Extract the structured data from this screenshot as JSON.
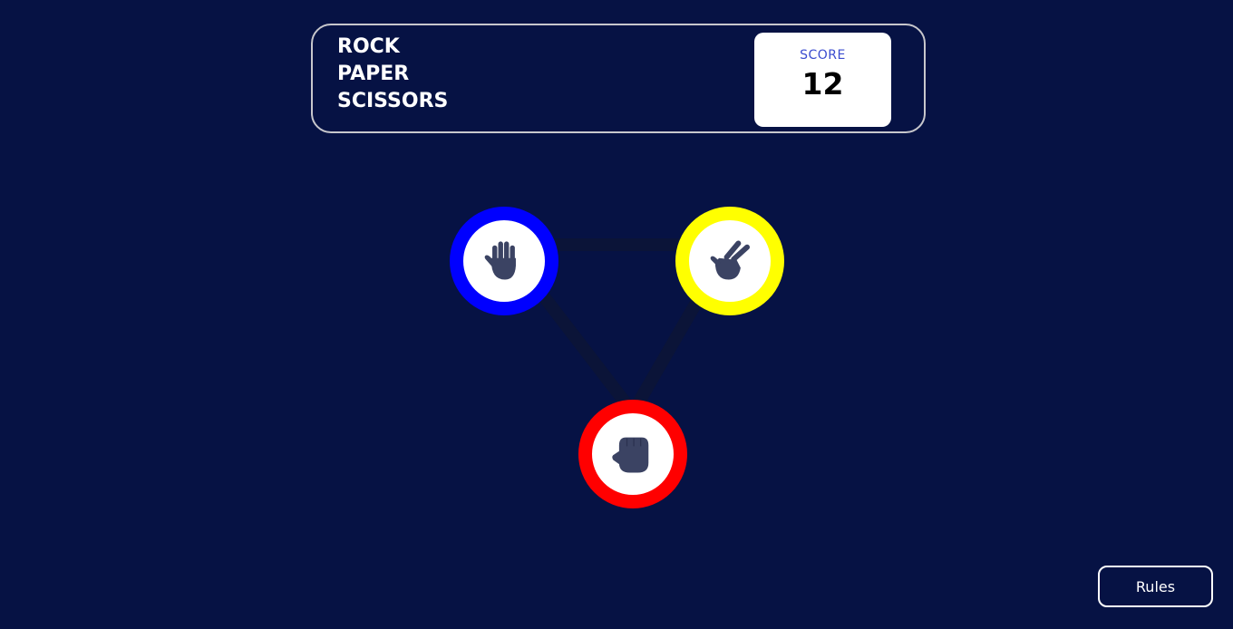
{
  "header": {
    "title_lines": [
      "ROCK",
      "PAPER",
      "SCISSORS"
    ],
    "score_label": "SCORE",
    "score_value": "12"
  },
  "choices": [
    {
      "id": "paper",
      "icon": "paper-hand-icon",
      "ring_color": "#0000ff"
    },
    {
      "id": "scissors",
      "icon": "scissors-hand-icon",
      "ring_color": "#ffff00"
    },
    {
      "id": "rock",
      "icon": "rock-fist-icon",
      "ring_color": "#ff0000"
    }
  ],
  "colors": {
    "background": "#061244",
    "triangle": "#0b1438",
    "icon": "#3b4363",
    "header_border": "#c7c7cc",
    "score_label": "#3b4ccf"
  },
  "footer": {
    "rules_label": "Rules"
  }
}
